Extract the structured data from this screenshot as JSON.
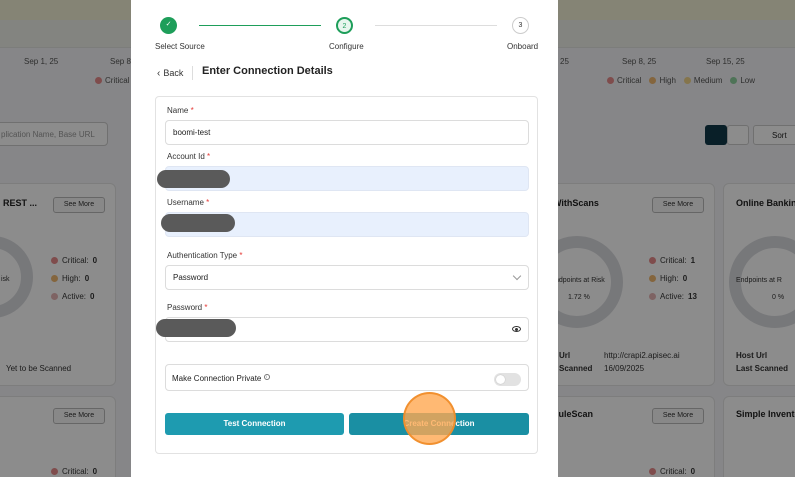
{
  "background": {
    "dates": [
      "Sep 1, 25",
      "Sep 8,",
      "25",
      "Sep 8, 25",
      "Sep 15, 25"
    ],
    "legend_left": {
      "label": "Critical",
      "color": "#e88a8a"
    },
    "legend_right": [
      {
        "label": "Critical",
        "color": "#e88a8a"
      },
      {
        "label": "High",
        "color": "#f0b870"
      },
      {
        "label": "Medium",
        "color": "#f2d68a"
      },
      {
        "label": "Low",
        "color": "#8fd19e"
      }
    ],
    "search_placeholder": "plication Name, Base URL",
    "sort_label": "Sort",
    "cards": {
      "c1": {
        "title": "REST ...",
        "see_more": "See More",
        "ring_text": "isk",
        "critical": "Critical:",
        "critical_val": "0",
        "high": "High:",
        "high_val": "0",
        "active": "Active:",
        "active_val": "0",
        "status": "Yet to be Scanned"
      },
      "c2": {
        "title": "WithScans",
        "see_more": "See More",
        "ring_line1": "ndpoints at Risk",
        "ring_line2": "1.72 %",
        "critical": "Critical:",
        "critical_val": "1",
        "high": "High:",
        "high_val": "0",
        "active": "Active:",
        "active_val": "13",
        "url_label": "Url",
        "url_value": "http://crapi2.apisec.ai",
        "scan_label": "Scanned",
        "scan_value": "16/09/2025"
      },
      "c3": {
        "title": "Online Banking",
        "ring_line1": "Endpoints at R",
        "ring_line2": "0 %",
        "url_label": "Host Url",
        "scan_label": "Last Scanned"
      },
      "c4": {
        "see_more": "See More",
        "critical": "Critical:",
        "critical_val": "0"
      },
      "c5": {
        "title": "duleScan",
        "see_more": "See More",
        "critical": "Critical:",
        "critical_val": "0"
      },
      "c6": {
        "title": "Simple Invento"
      }
    }
  },
  "modal": {
    "steps": [
      {
        "label": "Select Source",
        "marker": "✓"
      },
      {
        "label": "Configure",
        "marker": "2"
      },
      {
        "label": "Onboard",
        "marker": "3"
      }
    ],
    "back_label": "Back",
    "heading": "Enter Connection Details",
    "fields": {
      "name": {
        "label": "Name",
        "value": "boomi-test"
      },
      "account_id": {
        "label": "Account Id"
      },
      "username": {
        "label": "Username"
      },
      "auth_type": {
        "label": "Authentication Type",
        "value": "Password"
      },
      "password": {
        "label": "Password"
      }
    },
    "required_marker": "*",
    "private_label": "Make Connection Private",
    "private_enabled": false,
    "test_button": "Test Connection",
    "create_button": "Create Connection",
    "colors": {
      "primary": "#1e9bb0",
      "step_done": "#1e9e5a",
      "required": "#e53935"
    }
  }
}
